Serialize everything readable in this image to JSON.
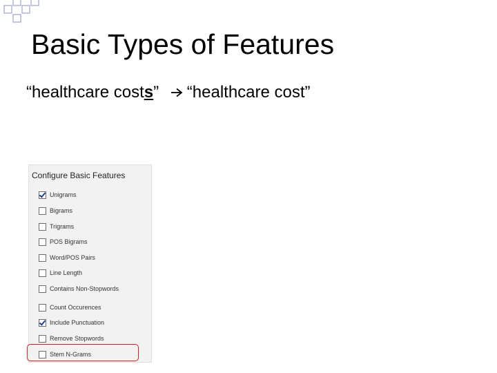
{
  "slide": {
    "title": "Basic Types of Features",
    "example": {
      "open_quote": "“",
      "word_before_prefix": "healthcare cost",
      "word_before_suffix": "s",
      "close_quote": "”",
      "arrow_icon": "arrow-right",
      "word_after": "“healthcare cost”"
    }
  },
  "panel": {
    "header": "Configure Basic Features",
    "options": [
      {
        "label": "Unigrams",
        "checked": true
      },
      {
        "label": "Bigrams",
        "checked": false
      },
      {
        "label": "Trigrams",
        "checked": false
      },
      {
        "label": "POS Bigrams",
        "checked": false
      },
      {
        "label": "Word/POS Pairs",
        "checked": false
      },
      {
        "label": "Line Length",
        "checked": false
      },
      {
        "label": "Contains Non-Stopwords",
        "checked": false
      },
      {
        "label": "Count Occurences",
        "checked": false
      },
      {
        "label": "Include Punctuation",
        "checked": true
      },
      {
        "label": "Remove Stopwords",
        "checked": false
      },
      {
        "label": "Stem N-Grams",
        "checked": false
      }
    ],
    "highlighted_option": "Stem N-Grams",
    "highlight_color": "#d02020"
  },
  "decoration_colors": {
    "square_outline": "#9aa3c7",
    "square_fill": "#ffffff"
  }
}
